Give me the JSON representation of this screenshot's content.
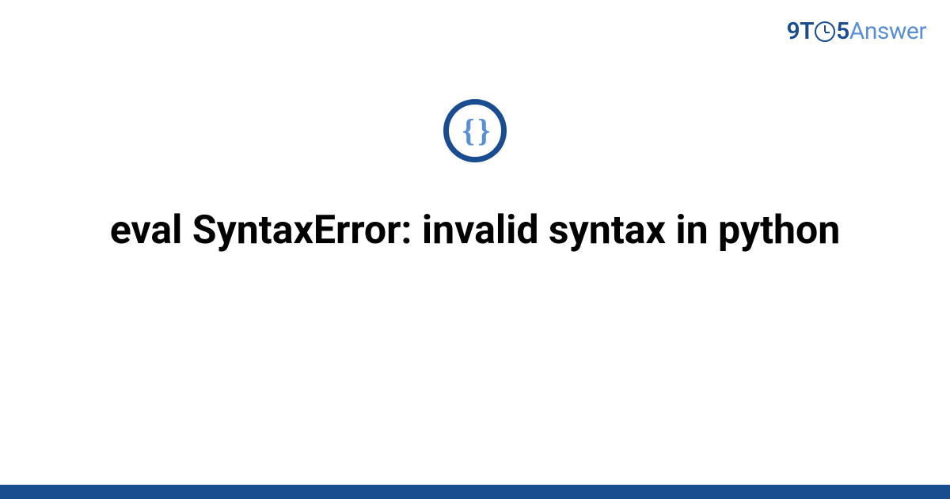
{
  "logo": {
    "part1": "9T",
    "part2": "5",
    "part3": "Answer"
  },
  "icon": {
    "braces": "{ }"
  },
  "title": "eval SyntaxError: invalid syntax in python",
  "colors": {
    "dark_blue": "#1a4d8f",
    "light_blue": "#5a8fd4",
    "black": "#000000",
    "white": "#ffffff"
  }
}
